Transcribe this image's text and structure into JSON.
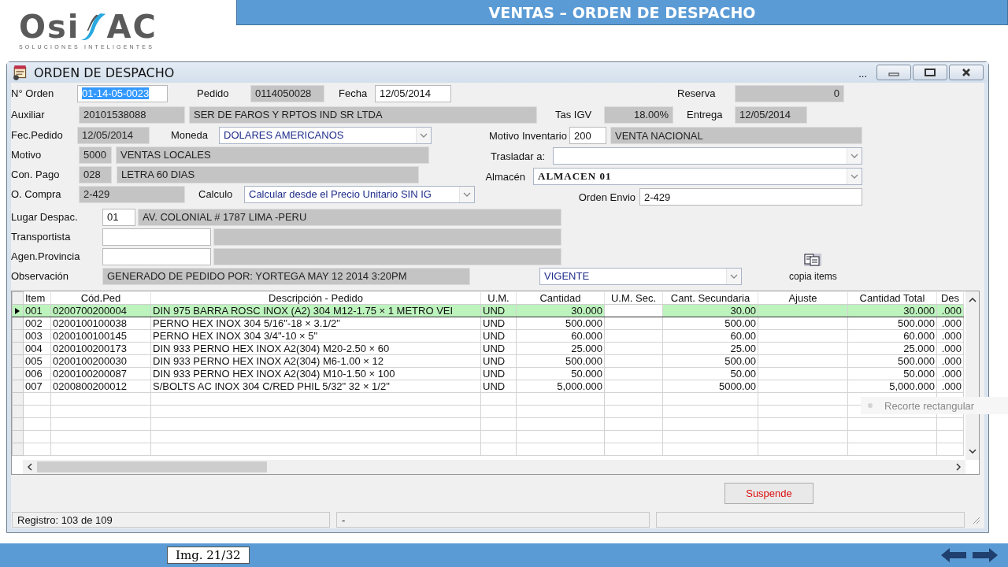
{
  "logo": {
    "wordmark_left": "Osi",
    "wordmark_right": "AC",
    "tagline": "SOLUCIONES INTELIGENTES"
  },
  "header": {
    "title": "VENTAS – ORDEN DE DESPACHO"
  },
  "window": {
    "title": "ORDEN DE DESPACHO",
    "menu_dots": "..."
  },
  "form": {
    "top_rows": [
      [
        {
          "kind": "label",
          "text": "N° Orden"
        },
        {
          "kind": "input",
          "text": "01-14-05-0023",
          "text_selected": true
        },
        {
          "kind": "label",
          "text": "Pedido"
        },
        {
          "kind": "readonly",
          "text": "0114050028"
        },
        {
          "kind": "label",
          "text": "Fecha"
        },
        {
          "kind": "input",
          "text": "12/05/2014",
          "text_selected": false
        },
        {
          "kind": "label",
          "text": "Reserva"
        },
        {
          "kind": "readonly",
          "text": "0"
        }
      ],
      [
        {
          "kind": "label",
          "text": "Auxiliar"
        },
        {
          "kind": "readonly",
          "text": "20101538088"
        },
        {
          "kind": "readonly",
          "text": "SER DE FAROS Y RPTOS IND SR LTDA"
        },
        {
          "kind": "label",
          "text": "Tas IGV"
        },
        {
          "kind": "readonly",
          "text": "18.00%"
        },
        {
          "kind": "label",
          "text": "Entrega"
        },
        {
          "kind": "readonly",
          "text": "12/05/2014"
        }
      ]
    ],
    "left_rows": [
      [
        {
          "kind": "label",
          "text": "Fec.Pedido"
        },
        {
          "kind": "readonly",
          "text": "12/05/2014"
        },
        {
          "kind": "label",
          "text": "Moneda"
        },
        {
          "kind": "combo",
          "text": "DOLARES AMERICANOS"
        }
      ],
      [
        {
          "kind": "label",
          "text": "Motivo"
        },
        {
          "kind": "readonly",
          "text": "5000"
        },
        {
          "kind": "readonly",
          "text": "VENTAS LOCALES"
        }
      ],
      [
        {
          "kind": "label",
          "text": "Con. Pago"
        },
        {
          "kind": "readonly",
          "text": "028"
        },
        {
          "kind": "readonly",
          "text": "LETRA 60 DIAS"
        }
      ],
      [
        {
          "kind": "label",
          "text": "O. Compra"
        },
        {
          "kind": "readonly",
          "text": "2-429"
        },
        {
          "kind": "label",
          "text": "Calculo"
        },
        {
          "kind": "combo",
          "text": "Calcular desde el Precio Unitario SIN IG"
        }
      ]
    ],
    "right_rows": [
      [
        {
          "kind": "label",
          "text": "Motivo Inventario"
        },
        {
          "kind": "input",
          "text": "200",
          "text_selected": false
        },
        {
          "kind": "readonly",
          "text": "VENTA NACIONAL"
        }
      ],
      [
        {
          "kind": "label",
          "text": "Trasladar a:"
        },
        {
          "kind": "combo"
        }
      ],
      [
        {
          "kind": "label",
          "text": "Almacén"
        },
        {
          "kind": "combo",
          "text": "ALMACEN 01"
        }
      ],
      [
        {
          "kind": "label",
          "text": "Orden Envio"
        },
        {
          "kind": "input",
          "text": "2-429",
          "text_selected": false
        }
      ]
    ],
    "bottom_rows": [
      [
        {
          "kind": "label",
          "text": "Lugar Despac."
        },
        {
          "kind": "input",
          "text": "01",
          "text_selected": false
        },
        {
          "kind": "readonly",
          "text": "AV. COLONIAL # 1787 LIMA -PERU"
        }
      ],
      [
        {
          "kind": "label",
          "text": "Transportista"
        },
        {
          "kind": "input"
        },
        {
          "kind": "readonly"
        }
      ],
      [
        {
          "kind": "label",
          "text": "Agen.Provincia"
        },
        {
          "kind": "input"
        },
        {
          "kind": "readonly"
        }
      ],
      [
        {
          "kind": "label",
          "text": "Observación"
        },
        {
          "kind": "readonly",
          "text": "GENERADO DE PEDIDO POR: YORTEGA MAY 12 2014  3:20PM"
        },
        {
          "kind": "combo",
          "text": "VIGENTE"
        }
      ]
    ]
  },
  "copy_button": {
    "label": "copia items"
  },
  "table": {
    "columns": [
      "Item",
      "Cód.Ped",
      "Descripción - Pedido",
      "U.M.",
      "Cantidad",
      "U.M. Sec.",
      "Cant. Secundaria",
      "Ajuste",
      "Cantidad Total",
      "Des"
    ],
    "rows": [
      {
        "selected": true,
        "item": "001",
        "code": "0200700200004",
        "description": "DIN 975 BARRA ROSC INOX (A2) 304 M12-1.75 × 1 METRO VEI",
        "unit": "UND",
        "quantity": "30.000",
        "secondary_quantity": "30.00",
        "total_quantity": "30.000",
        "dispatched": ".000"
      },
      {
        "selected": false,
        "item": "002",
        "code": "0200100100038",
        "description": "PERNO HEX INOX 304 5/16\"-18 × 3.1/2\"",
        "unit": "UND",
        "quantity": "500.000",
        "secondary_quantity": "500.00",
        "total_quantity": "500.000",
        "dispatched": ".000"
      },
      {
        "selected": false,
        "item": "003",
        "code": "0200100100145",
        "description": "PERNO HEX INOX 304 3/4\"-10 × 5\"",
        "unit": "UND",
        "quantity": "60.000",
        "secondary_quantity": "60.00",
        "total_quantity": "60.000",
        "dispatched": ".000"
      },
      {
        "selected": false,
        "item": "004",
        "code": "0200100200173",
        "description": "DIN 933 PERNO HEX INOX A2(304) M20-2.50 × 60",
        "unit": "UND",
        "quantity": "25.000",
        "secondary_quantity": "25.00",
        "total_quantity": "25.000",
        "dispatched": ".000"
      },
      {
        "selected": false,
        "item": "005",
        "code": "0200100200030",
        "description": "DIN 933 PERNO HEX INOX A2(304) M6-1.00 × 12",
        "unit": "UND",
        "quantity": "500.000",
        "secondary_quantity": "500.00",
        "total_quantity": "500.000",
        "dispatched": ".000"
      },
      {
        "selected": false,
        "item": "006",
        "code": "0200100200087",
        "description": "DIN 933 PERNO HEX INOX A2(304) M10-1.50 × 100",
        "unit": "UND",
        "quantity": "50.000",
        "secondary_quantity": "50.00",
        "total_quantity": "50.000",
        "dispatched": ".000"
      },
      {
        "selected": false,
        "item": "007",
        "code": "0200800200012",
        "description": "S/BOLTS AC INOX 304 C/RED PHIL 5/32\" 32 × 1/2\"",
        "unit": "UND",
        "quantity": "5,000.000",
        "secondary_quantity": "5000.00",
        "total_quantity": "5,000.000",
        "dispatched": ".000"
      }
    ]
  },
  "suspend_button": {
    "label": "Suspende"
  },
  "status_bar": {
    "record": "Registro: 103 de 109",
    "panel_2": "-"
  },
  "snip_tooltip": "Recorte rectangular",
  "footer": {
    "page_label": "Img. 21/32"
  }
}
